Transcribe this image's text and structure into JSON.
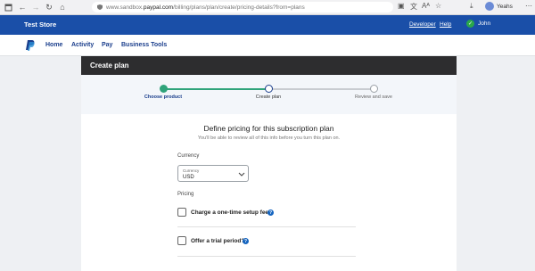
{
  "browser": {
    "url_prefix": "www.sandbox.",
    "url_host": "paypal.com",
    "url_path": "/billing/plans/plan/create/pricing-details?from=plans",
    "profile_name": "Yeahs"
  },
  "header": {
    "store_name": "Test Store",
    "developer_link": "Developer",
    "help_link": "Help",
    "user_name": "John"
  },
  "nav": {
    "items": [
      "Home",
      "Activity",
      "Pay",
      "Business Tools"
    ]
  },
  "card": {
    "title": "Create plan"
  },
  "stepper": {
    "steps": [
      {
        "label": "Choose product",
        "status": "complete"
      },
      {
        "label": "Create plan",
        "status": "current"
      },
      {
        "label": "Review and save",
        "status": "pending"
      }
    ],
    "colors": {
      "complete": "#2fa37a",
      "current": "#1a3e8c",
      "pending": "#9aa0a6"
    }
  },
  "pricing": {
    "heading": "Define pricing for this subscription plan",
    "subheading": "You'll be able to review all of this info before you turn this plan on.",
    "currency_section_label": "Currency",
    "currency_field_caption": "Currency",
    "currency_value": "USD",
    "pricing_section_label": "Pricing",
    "setup_fee_label": "Charge a one-time setup fee?",
    "trial_label": "Offer a trial period?"
  }
}
